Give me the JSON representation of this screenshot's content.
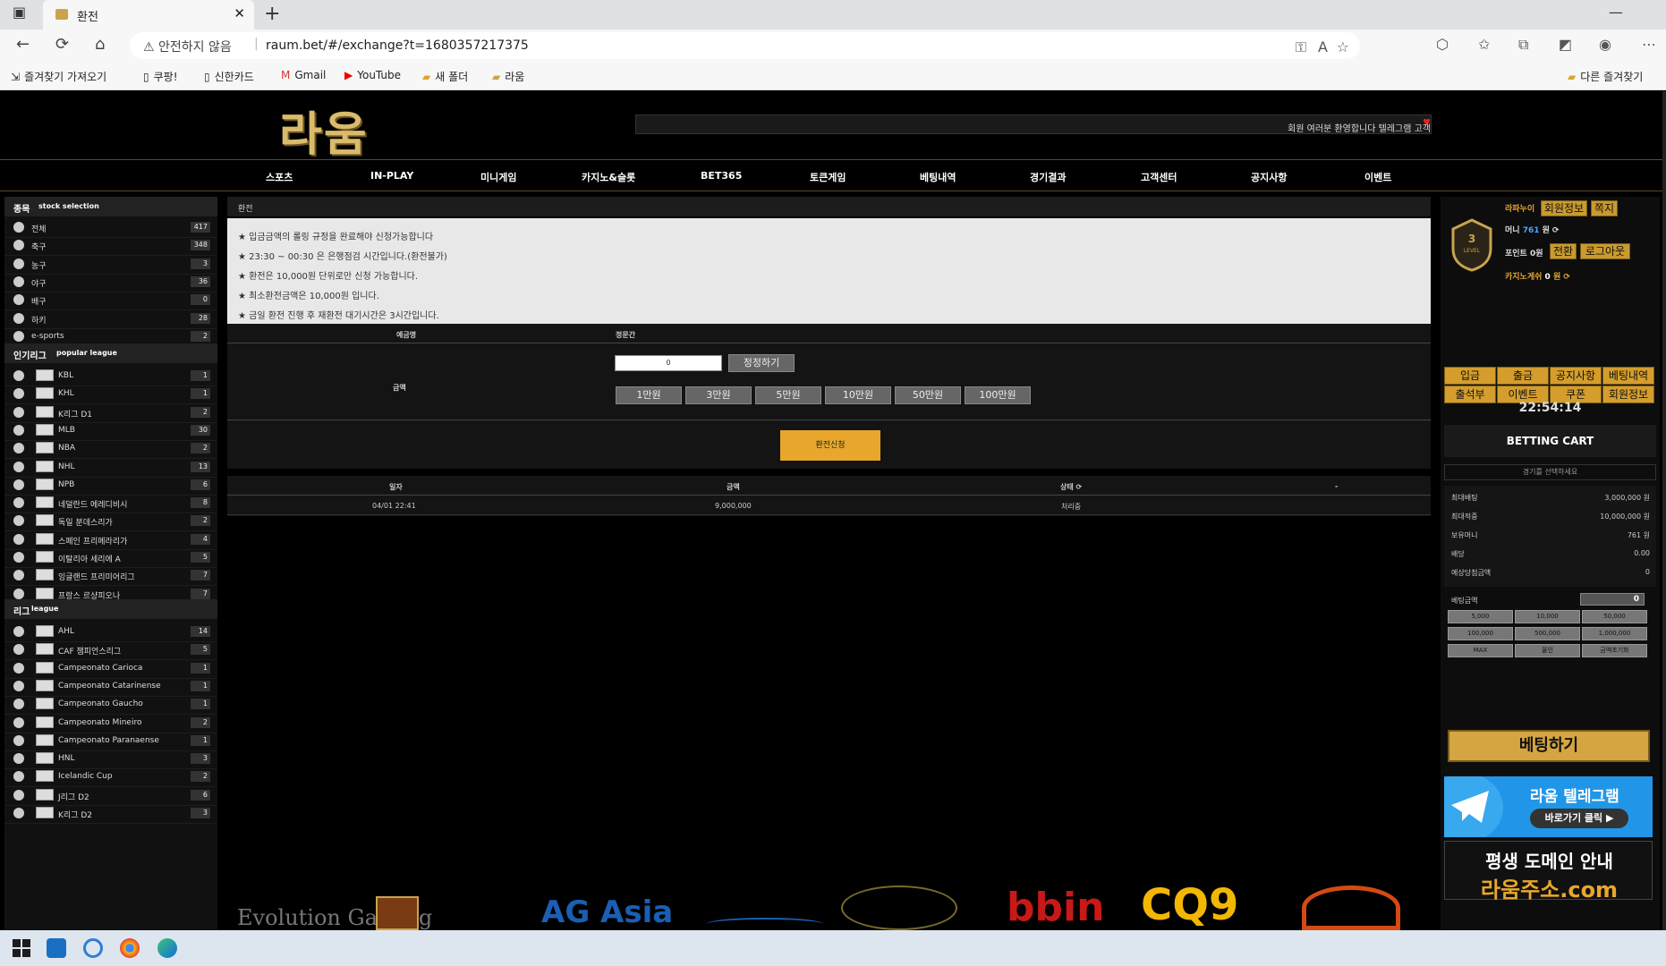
{
  "browser": {
    "tab_title": "환전",
    "close": "✕",
    "newtab": "+",
    "minimize": "—",
    "maximize": "☐",
    "close_window": "✕",
    "insecure": "안전하지 않음",
    "url": "raum.bet/#/exchange?t=1680357217375",
    "back": "←",
    "reload": "⟳",
    "home": "⌂"
  },
  "bookmarks": [
    "즐겨찾기 가져오기",
    "쿠팡!",
    "신한카드",
    "Gmail",
    "YouTube",
    "새 폴더",
    "라움"
  ],
  "bookmarks_right": "다른 즐겨찾기",
  "site": {
    "logo": "라움",
    "ticker": "회원 여러분 환영합니다 텔레그램 고객",
    "menu": [
      "스포츠",
      "IN-PLAY",
      "미니게임",
      "카지노&슬롯",
      "BET365",
      "토큰게임",
      "베팅내역",
      "경기결과",
      "고객센터",
      "공지사항",
      "이벤트"
    ],
    "sidebar": {
      "sport_head": "종목",
      "sport_head_sub": "stock selection",
      "sports": [
        {
          "name": "전체",
          "count": "417"
        },
        {
          "name": "축구",
          "count": "348"
        },
        {
          "name": "농구",
          "count": "3"
        },
        {
          "name": "야구",
          "count": "36"
        },
        {
          "name": "배구",
          "count": "0"
        },
        {
          "name": "하키",
          "count": "28"
        },
        {
          "name": "e-sports",
          "count": "2"
        }
      ],
      "popular_head": "인기리그",
      "popular_head_sub": "popular league",
      "popular": [
        {
          "name": "KBL",
          "count": "1"
        },
        {
          "name": "KHL",
          "count": "1"
        },
        {
          "name": "K리그 D1",
          "count": "2"
        },
        {
          "name": "MLB",
          "count": "30"
        },
        {
          "name": "NBA",
          "count": "2"
        },
        {
          "name": "NHL",
          "count": "13"
        },
        {
          "name": "NPB",
          "count": "6"
        },
        {
          "name": "네덜란드 에레디비시",
          "count": "8"
        },
        {
          "name": "독일 분데스리가",
          "count": "2"
        },
        {
          "name": "스페인 프리메라리가",
          "count": "4"
        },
        {
          "name": "이탈리아 세리에 A",
          "count": "5"
        },
        {
          "name": "잉글랜드 프리미어리그",
          "count": "7"
        },
        {
          "name": "프랑스 르샹피오나",
          "count": "7"
        }
      ],
      "league_head": "리그",
      "league_head_sub": "league",
      "leagues": [
        {
          "name": "AHL",
          "count": "14"
        },
        {
          "name": "CAF 챔피언스리그",
          "count": "5"
        },
        {
          "name": "Campeonato Carioca",
          "count": "1"
        },
        {
          "name": "Campeonato Catarinense",
          "count": "1"
        },
        {
          "name": "Campeonato Gaucho",
          "count": "1"
        },
        {
          "name": "Campeonato Mineiro",
          "count": "2"
        },
        {
          "name": "Campeonato Paranaense",
          "count": "1"
        },
        {
          "name": "HNL",
          "count": "3"
        },
        {
          "name": "Icelandic Cup",
          "count": "2"
        },
        {
          "name": "J리그 D2",
          "count": "6"
        },
        {
          "name": "K리그 D2",
          "count": "3"
        }
      ]
    },
    "main": {
      "title": "환전",
      "notices": [
        "★ 입금금액의 롤링 규정을 완료해야 신청가능합니다",
        "★ 23:30 ~ 00:30 은 은행점검 시간입니다.(환전불가)",
        "★ 환전은 10,000원 단위로만 신청 가능합니다.",
        "★ 최소환전금액은 10,000원 입니다.",
        "★ 금일 환전 진행 후 재환전 대기시간은 3시간입니다."
      ],
      "col_depositor": "예금명",
      "col_value": "정문간",
      "amount_label": "금액",
      "amount_value": "0",
      "reset": "정정하기",
      "quick": [
        "1만원",
        "3만원",
        "5만원",
        "10만원",
        "50만원",
        "100만원"
      ],
      "submit": "환전신청",
      "history_head": [
        "일자",
        "금액",
        "상태 ⟳",
        "-"
      ],
      "history": [
        {
          "date": "04/01 22:41",
          "amount": "9,000,000",
          "status": "처리중"
        }
      ]
    },
    "banners": [
      "Evolution Gaming",
      "AG Asia",
      "bbin",
      "CQ9"
    ],
    "right": {
      "user": "라파누이",
      "member_info": "회원정보",
      "msg": "쪽지",
      "money_label": "머니",
      "money_value": "761",
      "money_unit": "원 ⟳",
      "point_label": "포인트",
      "point_value": "0원",
      "convert": "전환",
      "logout": "로그아웃",
      "casino_label": "카지노게쉬",
      "casino_value": "0",
      "casino_unit": "원 ⟳",
      "level": "3",
      "level_txt": "LEVEL",
      "quick": [
        "입금",
        "출금",
        "공지사항",
        "베팅내역",
        "출석부",
        "이벤트",
        "쿠폰",
        "회원정보"
      ],
      "clock": "22:54:14",
      "cart_title": "BETTING CART",
      "cart_select": "경기를 선택하세요",
      "info": [
        {
          "k": "최대배팅",
          "v": "3,000,000 원"
        },
        {
          "k": "최대적중",
          "v": "10,000,000 원"
        },
        {
          "k": "보유머니",
          "v": "761 원"
        },
        {
          "k": "배당",
          "v": "0.00"
        },
        {
          "k": "예상당첨금액",
          "v": "0"
        }
      ],
      "bet_label": "베팅금액",
      "bet_value": "0",
      "chips": [
        "5,000",
        "10,000",
        "50,000",
        "100,000",
        "500,000",
        "1,000,000",
        "MAX",
        "올인",
        "금액초기화"
      ],
      "bet_btn": "베팅하기",
      "tg_title": "라움 텔레그램",
      "tg_btn": "바로가기 클릭 ▶",
      "domain_title": "평생 도메인 안내",
      "domain_url": "라움주소.com"
    }
  }
}
